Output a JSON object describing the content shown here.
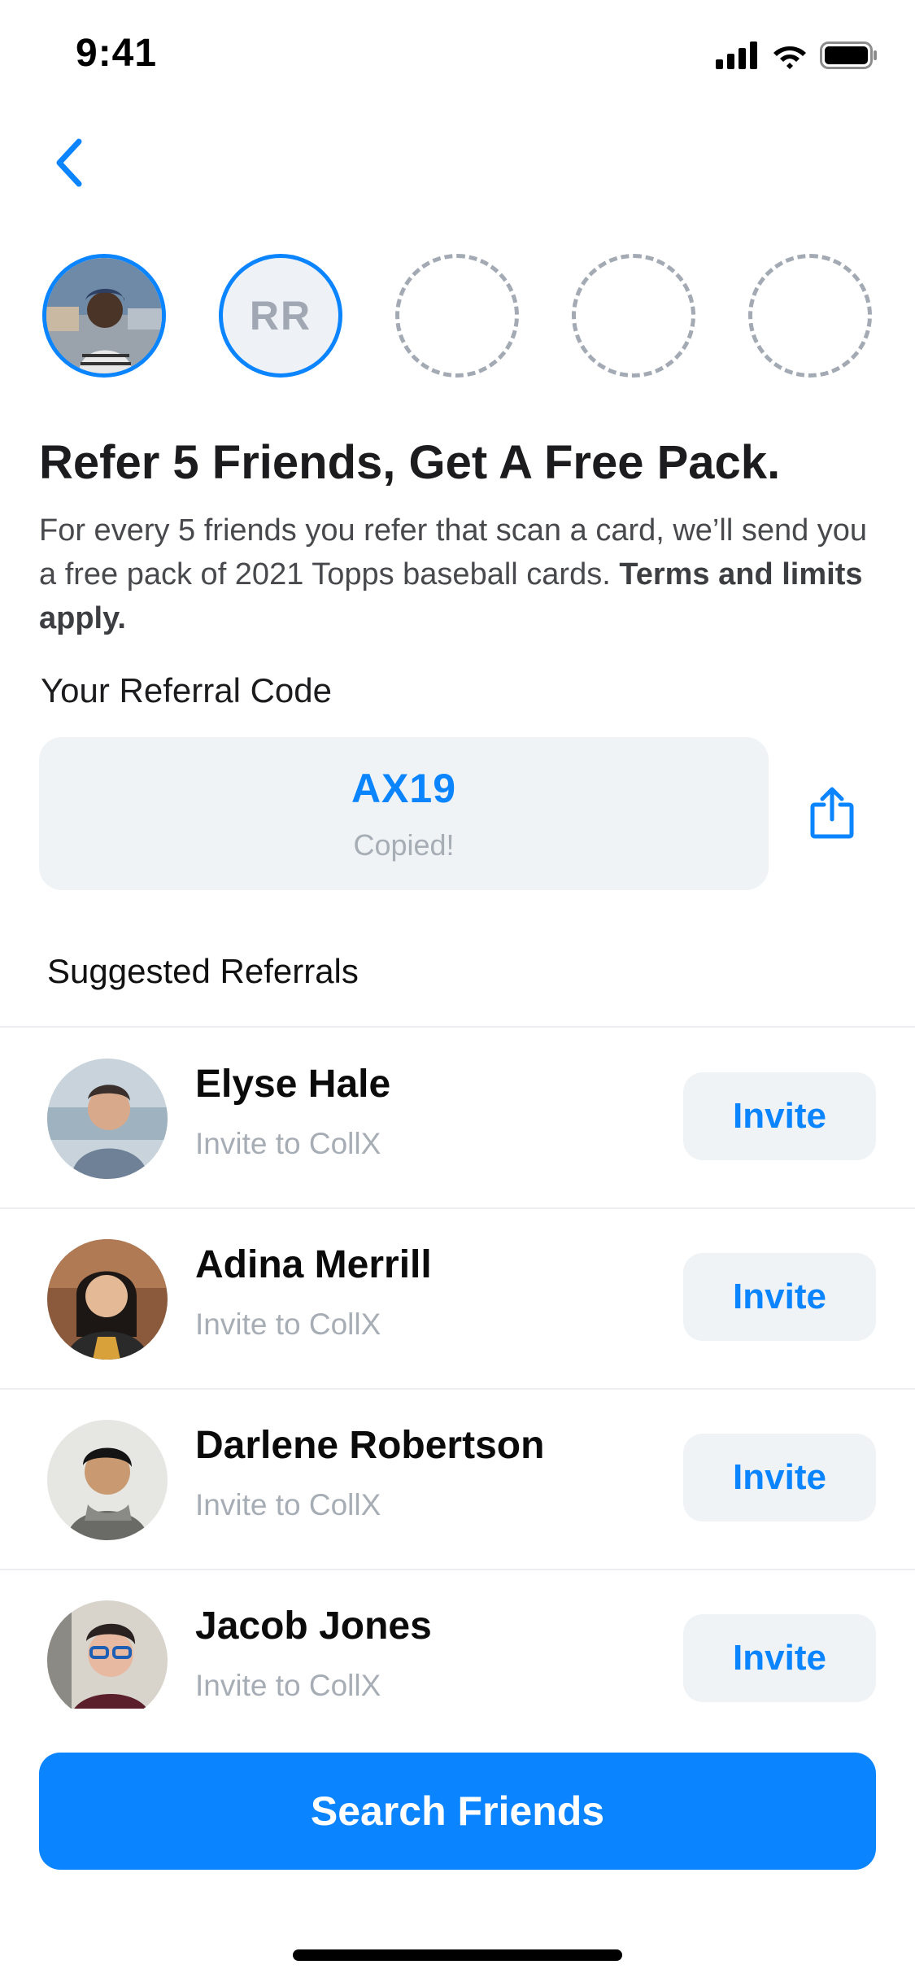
{
  "status_bar": {
    "time": "9:41"
  },
  "referral_progress": {
    "slots": [
      {
        "type": "photo",
        "icon": "person-photo-avatar"
      },
      {
        "type": "initials",
        "initials": "RR"
      },
      {
        "type": "empty"
      },
      {
        "type": "empty"
      },
      {
        "type": "empty"
      }
    ]
  },
  "headline": "Refer 5 Friends, Get A Free Pack.",
  "body": {
    "text": "For every 5 friends you refer that scan a card, we’ll send you a free pack of 2021 Topps baseball cards. ",
    "emphasis": "Terms and limits apply."
  },
  "referral_code": {
    "label": "Your Referral Code",
    "code": "AX19",
    "status": "Copied!"
  },
  "suggested": {
    "title": "Suggested Referrals",
    "rows": [
      {
        "name": "Elyse Hale",
        "subtitle": "Invite to CollX",
        "action": "Invite"
      },
      {
        "name": "Adina Merrill",
        "subtitle": "Invite to CollX",
        "action": "Invite"
      },
      {
        "name": "Darlene Robertson",
        "subtitle": "Invite to CollX",
        "action": "Invite"
      },
      {
        "name": "Jacob Jones",
        "subtitle": "Invite to CollX",
        "action": "Invite"
      }
    ]
  },
  "search_button": "Search Friends",
  "colors": {
    "accent": "#0a84ff",
    "surface": "#eff3f6",
    "muted": "#a7adb5",
    "text": "#1c1c1e"
  }
}
